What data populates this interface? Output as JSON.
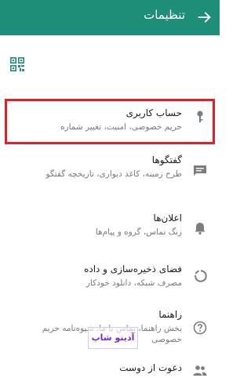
{
  "appbar": {
    "title": "تنظیمات",
    "back_icon": "arrow-back-icon",
    "color": "#1f8e78"
  },
  "qr_icon": "qr-code-icon",
  "items": [
    {
      "title": "حساب کاربری",
      "subtitle": "حریم خصوصی، امنیت، تغییر شماره",
      "icon": "key-icon"
    },
    {
      "title": "گفتگوها",
      "subtitle": "طرح زمینه، کاغذ دیواری، تاریخچه گفتگو",
      "icon": "chat-icon"
    },
    {
      "title": "اعلان‌ها",
      "subtitle": "زنگ تماس، گروه و پیام‌ها",
      "icon": "bell-icon"
    },
    {
      "title": "فضای ذخیره‌سازی و داده",
      "subtitle": "مصرف شبکه، دانلود خودکار",
      "icon": "data-usage-icon"
    },
    {
      "title": "راهنما",
      "subtitle": "بخش راهنما، تماس با ما، شیوه‌نامه حریم خصوصی",
      "icon": "help-icon"
    },
    {
      "title": "دعوت از دوست",
      "subtitle": "",
      "icon": "people-icon"
    }
  ],
  "highlight_color": "#e31e24",
  "watermark": {
    "text": "آدینو شاپ"
  }
}
